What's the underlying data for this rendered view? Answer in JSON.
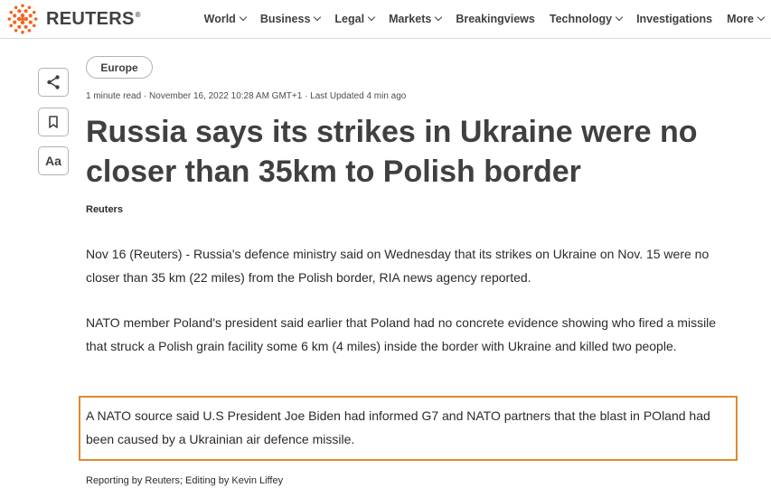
{
  "header": {
    "brand": "REUTERS",
    "brand_mark": "®",
    "nav": [
      {
        "label": "World",
        "has_dropdown": true
      },
      {
        "label": "Business",
        "has_dropdown": true
      },
      {
        "label": "Legal",
        "has_dropdown": true
      },
      {
        "label": "Markets",
        "has_dropdown": true
      },
      {
        "label": "Breakingviews",
        "has_dropdown": false
      },
      {
        "label": "Technology",
        "has_dropdown": true
      },
      {
        "label": "Investigations",
        "has_dropdown": false
      },
      {
        "label": "More",
        "has_dropdown": true
      }
    ]
  },
  "sidebar": {
    "share_icon": "share-icon",
    "bookmark_icon": "bookmark-icon",
    "text_size_label": "Aa"
  },
  "article": {
    "section_tag": "Europe",
    "meta": "1 minute read · November 16, 2022 10:28 AM GMT+1 · Last Updated 4 min ago",
    "headline": "Russia says its strikes in Ukraine were no closer than 35km to Polish border",
    "byline": "Reuters",
    "paragraphs": [
      "Nov 16 (Reuters) - Russia's defence ministry said on Wednesday that its strikes on Ukraine on Nov. 15 were no closer than 35 km (22 miles) from the Polish border, RIA news agency reported.",
      "NATO member Poland's president said earlier that Poland had no concrete evidence showing who fired a missile that struck a Polish grain facility some 6 km (4 miles) inside the border with Ukraine and killed two people.",
      "A NATO source said U.S President Joe Biden had informed G7 and NATO partners that the blast in POland had been caused by a Ukrainian air defence missile."
    ],
    "credits": "Reporting by Reuters; Editing by Kevin Liffey"
  },
  "colors": {
    "brand_orange": "#f26722",
    "highlight_border": "#e0892e",
    "text": "#404040"
  }
}
